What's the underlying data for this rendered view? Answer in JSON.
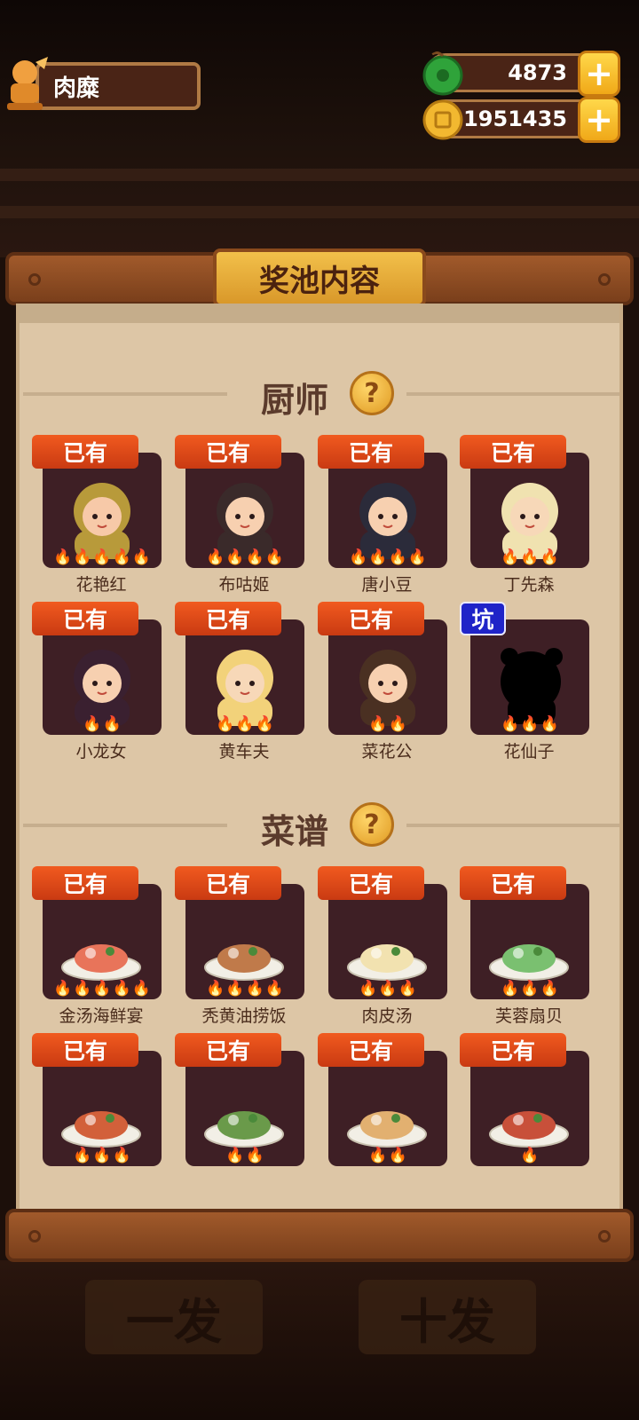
{
  "header": {
    "title": "肉糜",
    "jade": "4873",
    "coins": "1951435",
    "plus": "+"
  },
  "panel": {
    "title": "奖池内容",
    "help": "?"
  },
  "sections": {
    "chefs": {
      "label": "厨师",
      "items": [
        {
          "tag": "已有",
          "name": "花艳红",
          "flames": 5
        },
        {
          "tag": "已有",
          "name": "布咕姬",
          "flames": 4
        },
        {
          "tag": "已有",
          "name": "唐小豆",
          "flames": 4
        },
        {
          "tag": "已有",
          "name": "丁先森",
          "flames": 3
        },
        {
          "tag": "已有",
          "name": "小龙女",
          "flames": 2
        },
        {
          "tag": "已有",
          "name": "黄车夫",
          "flames": 3
        },
        {
          "tag": "已有",
          "name": "菜花公",
          "flames": 2
        },
        {
          "tag": "坑",
          "name": "花仙子",
          "flames": 3
        }
      ]
    },
    "recipes": {
      "label": "菜谱",
      "items": [
        {
          "tag": "已有",
          "name": "金汤海鲜宴",
          "flames": 5
        },
        {
          "tag": "已有",
          "name": "秃黄油捞饭",
          "flames": 4
        },
        {
          "tag": "已有",
          "name": "肉皮汤",
          "flames": 3
        },
        {
          "tag": "已有",
          "name": "芙蓉扇贝",
          "flames": 3
        },
        {
          "tag": "已有",
          "name": "",
          "flames": 3
        },
        {
          "tag": "已有",
          "name": "",
          "flames": 2
        },
        {
          "tag": "已有",
          "name": "",
          "flames": 2
        },
        {
          "tag": "已有",
          "name": "",
          "flames": 1
        }
      ]
    }
  },
  "bottom_buttons": {
    "single": "一发",
    "ten": "十发"
  },
  "icons": {
    "flame": "flame-icon",
    "jade": "jade-icon",
    "coin": "coin-icon"
  },
  "colors": {
    "tag_owned": "#e2491a",
    "tag_missing": "#1f24c8",
    "flame": "#ff6a1a"
  }
}
